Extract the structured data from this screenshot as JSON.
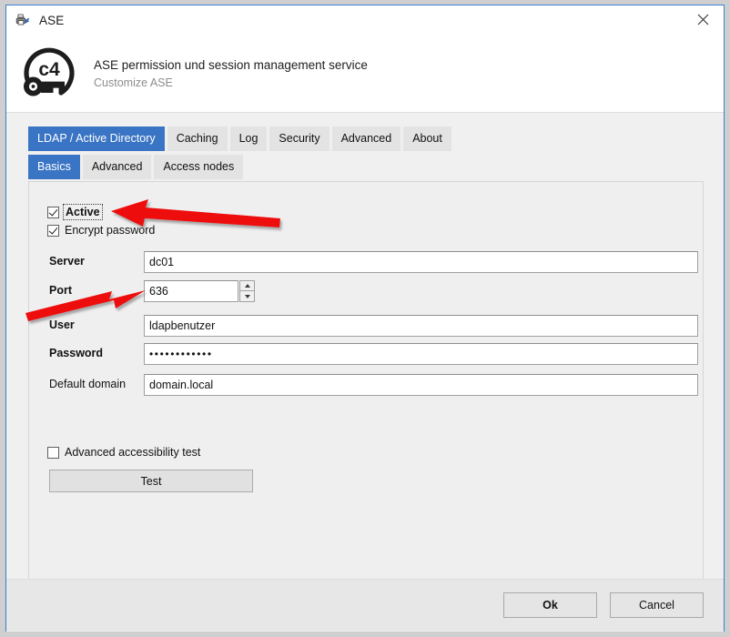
{
  "window": {
    "title": "ASE",
    "app_icon": "printer-document-icon",
    "close_icon": "close-icon",
    "accent_color": "#3a74c4",
    "titlebar_bg": "#ffffff",
    "dialog_bg": "#f0f0f0"
  },
  "header": {
    "logo_icon": "c4-key-shield-logo",
    "logo_text": "c4",
    "title": "ASE permission und session management service",
    "subtitle": "Customize ASE"
  },
  "tabs_main": [
    {
      "label": "LDAP / Active Directory",
      "active": true
    },
    {
      "label": "Caching",
      "active": false
    },
    {
      "label": "Log",
      "active": false
    },
    {
      "label": "Security",
      "active": false
    },
    {
      "label": "Advanced",
      "active": false
    },
    {
      "label": "About",
      "active": false
    }
  ],
  "tabs_sub": [
    {
      "label": "Basics",
      "active": true
    },
    {
      "label": "Advanced",
      "active": false
    },
    {
      "label": "Access nodes",
      "active": false
    }
  ],
  "form": {
    "checkbox_active": {
      "label": "Active",
      "checked": true,
      "focused": true,
      "bold": true
    },
    "checkbox_encrypt": {
      "label": "Encrypt password",
      "checked": true,
      "focused": false,
      "bold": false
    },
    "server": {
      "label": "Server",
      "value": "dc01",
      "bold": true
    },
    "port": {
      "label": "Port",
      "value": "636",
      "bold": true,
      "spinner_up": "spinner-up-icon",
      "spinner_down": "spinner-down-icon"
    },
    "user": {
      "label": "User",
      "value": "ldapbenutzer",
      "bold": true
    },
    "password": {
      "label": "Password",
      "value": "••••••••••••",
      "bold": true
    },
    "default_domain": {
      "label": "Default domain",
      "value": "domain.local",
      "bold": false
    },
    "checkbox_acc_test": {
      "label": "Advanced accessibility test",
      "checked": false
    },
    "test_button": {
      "label": "Test"
    }
  },
  "footer": {
    "ok_label": "Ok",
    "cancel_label": "Cancel"
  },
  "annotations": {
    "arrow_color": "#ee1111",
    "arrow_active": "arrow-pointing-to-active-checkbox",
    "arrow_port": "arrow-pointing-to-port-field"
  }
}
